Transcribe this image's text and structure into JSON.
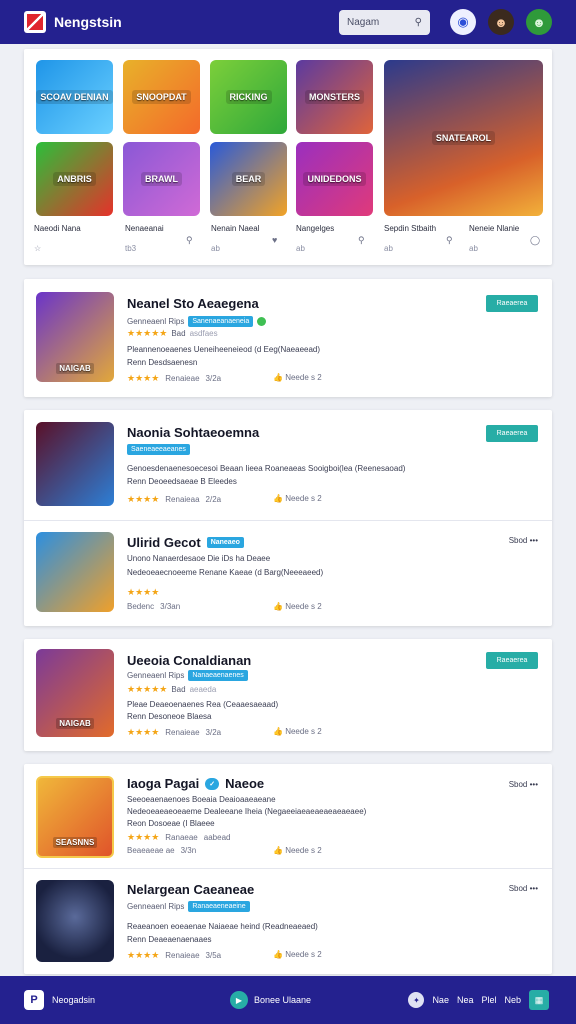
{
  "header": {
    "brand": "Nengstsin",
    "search_placeholder": "Nagam",
    "icons": [
      "controller-icon",
      "avatar-boy-icon",
      "avatar-green-icon"
    ]
  },
  "featured": {
    "tiles": [
      {
        "caption": "SCOAV DENIAN",
        "color": "#1f95e8"
      },
      {
        "caption": "SNOOPDAT",
        "color": "#e8b12a"
      },
      {
        "caption": "RICKING",
        "color": "#7ccf3a"
      },
      {
        "caption": "MONSTERS",
        "color": "#5b3aa0"
      },
      {
        "caption": "ANBRIS",
        "color": "#e6312a"
      },
      {
        "caption": "BRAWL",
        "color": "#8a58d6"
      },
      {
        "caption": "BEAR",
        "color": "#f2a326"
      },
      {
        "caption": "UNIDEDONS",
        "color": "#9a2fbf"
      },
      {
        "caption": "SNATEAROL",
        "color": "#2b3a8c"
      }
    ],
    "labels": [
      {
        "label": "Naeodi Nana",
        "meta": ""
      },
      {
        "label": "Nenaeanai",
        "meta": "tb3"
      },
      {
        "label": "Nenain Naeal",
        "meta": "ab"
      },
      {
        "label": "Nangelges",
        "meta": "ab"
      },
      {
        "label": "Sepdin Stbaith",
        "meta": "ab"
      },
      {
        "label": "Neneie Nlanie",
        "meta": "ab"
      }
    ]
  },
  "apps": [
    {
      "title": "Neanel Sto Aeaegena",
      "sub": "Genneaenl Rips",
      "chip": "Sanenaeanaeneia",
      "stars": "★★★★★",
      "rating": "Bad",
      "count": "asdfaes",
      "desc1": "Pleannenoeaenes Ueneiheeneieod (d Eeg(Naeaeead)",
      "desc2": "Renn Desdsaenesn",
      "meta_stars": "★★★★",
      "meta_text": "Renaieae",
      "meta_num": "3/2a",
      "like": "Neede s 2",
      "button": "Raeaerea",
      "icon_caption": "NAIGAB",
      "icon_color": "#6a34c9"
    },
    {
      "title": "Naonia Sohtaeoemna",
      "sub": "",
      "chip": "Saeneaeeaeanes",
      "stars": "",
      "rating": "",
      "count": "",
      "desc1": "Genoesdenaenesoecesoi Beaan Iieea Roaneaeas Sooigboi(lea (Reenesaoad)",
      "desc2": "Renn Deoeedsaeae B Eleedes",
      "meta_stars": "★★★★",
      "meta_text": "Renaieaa",
      "meta_num": "2/2a",
      "like": "Neede s 2",
      "button": "Raeaerea",
      "icon_caption": "",
      "icon_color": "#5a1028"
    },
    {
      "title": "Ulirid Gecot",
      "sub": "",
      "chip": "Naneaeo",
      "stars": "",
      "rating": "",
      "count": "",
      "desc1": "Unono Nanaerdesaoe Die iDs ha Deaee",
      "desc2": "Nedeoeaecnoeeme Renane Kaeae (d Barg(Neeeaeed)",
      "meta_stars": "★★★★",
      "meta_text": "Bedenc",
      "meta_num": "3/3an",
      "like": "Neede s 2",
      "button": "",
      "more": "Sbod •••",
      "icon_caption": "",
      "icon_color": "#2c8fe0"
    },
    {
      "title": "Ueeoia Conaldianan",
      "sub": "Genneaenl Rips",
      "chip": "Nanaeaenaenes",
      "stars": "★★★★★",
      "rating": "Bad",
      "count": "aeaeda",
      "desc1": "Pleae Deaeoenaenes Rea (Ceaaesaeaad)",
      "desc2": "Renn Desoneoe Blaesa",
      "meta_stars": "★★★★",
      "meta_text": "Renaieae",
      "meta_num": "3/2a",
      "like": "Neede s 2",
      "button": "Raeaerea",
      "icon_caption": "NAIGAB",
      "icon_color": "#7b3a98"
    },
    {
      "title": "Iaoga Pagai",
      "sub": "",
      "chip": "",
      "stars": "",
      "rating": "",
      "count": "",
      "title_badge": "Naeoe",
      "desc1": "Seeoeaenaenoes Boeaia Deaioaaeaeane",
      "desc2": "Nedeoeaeaeoeaeme Dealeeane Iheia (Negaeeiaeaeaeaeaeaeaee)",
      "desc3": "Reon Dosoeae (I Blaeee",
      "meta_stars": "★★★★",
      "meta_text": "Ranaeae",
      "meta_num": "aabead",
      "meta_text2": "Beaeaeae ae",
      "meta_num2": "3/3n",
      "like": "Neede s 2",
      "button": "",
      "more": "Sbod •••",
      "icon_caption": "SEASNNS",
      "icon_color": "#f0b73a"
    },
    {
      "title": "Nelargean Caeaneae",
      "sub": "Genneaenl Rips",
      "chip": "Ranaeaeneaeine",
      "stars": "",
      "rating": "",
      "count": "",
      "desc1": "Reaeanoen eoeaenae Naiaeae heind (Readneaeaed)",
      "desc2": "Renn Deaeaenaenaaes",
      "meta_stars": "★★★★",
      "meta_text": "Renaieae",
      "meta_num": "3/5a",
      "like": "Neede s 2",
      "button": "",
      "more": "Sbod •••",
      "icon_caption": "",
      "icon_color": "#202a4a"
    }
  ],
  "footer": {
    "brand": "Neogadsin",
    "center": "Bonee Ulaane",
    "links": [
      "Nae",
      "Nea",
      "Plel",
      "Neb"
    ]
  },
  "colors": {
    "header": "#24218f",
    "accent": "#27ada6",
    "chip": "#2aa6e0",
    "star": "#f4a516"
  }
}
